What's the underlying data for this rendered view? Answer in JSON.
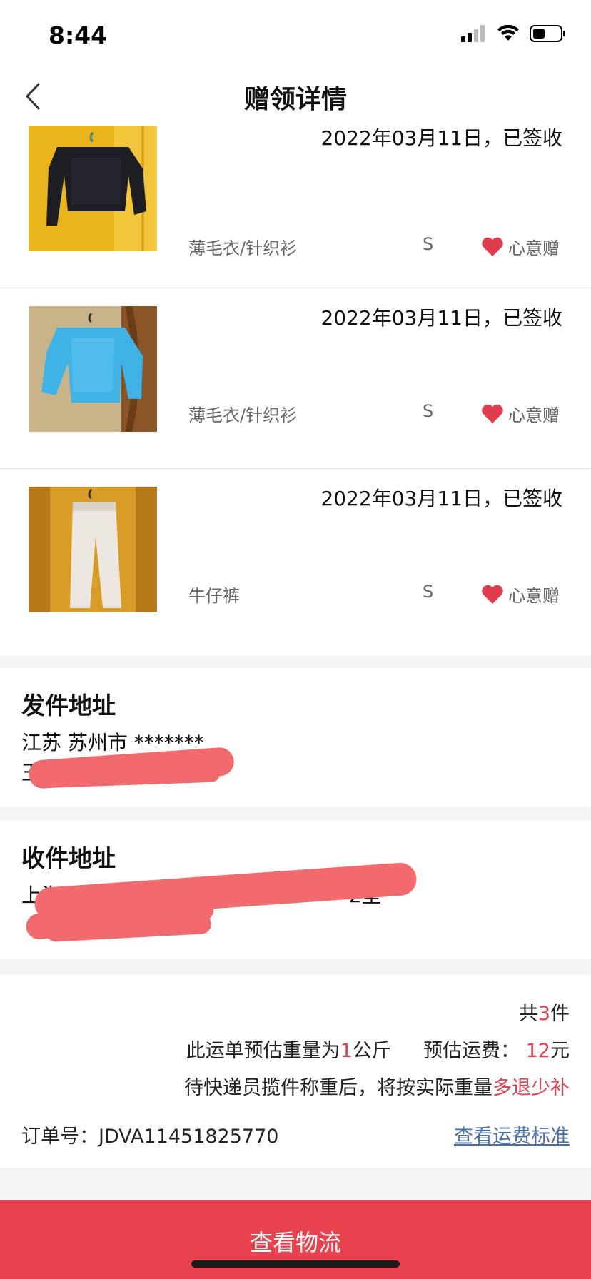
{
  "status_bar": {
    "time": "8:44"
  },
  "header": {
    "title": "赠领详情"
  },
  "items": [
    {
      "date": "2022年03月11日，已签收",
      "category": "薄毛衣/针织衫",
      "size": "S",
      "tag": "心意赠",
      "image": "black-sweater"
    },
    {
      "date": "2022年03月11日，已签收",
      "category": "薄毛衣/针织衫",
      "size": "S",
      "tag": "心意赠",
      "image": "blue-sweater"
    },
    {
      "date": "2022年03月11日，已签收",
      "category": "牛仔裤",
      "size": "S",
      "tag": "心意赠",
      "image": "white-jeans"
    }
  ],
  "sender": {
    "title": "发件地址",
    "line1": "江苏 苏州市 *******",
    "line2": "王"
  },
  "receiver": {
    "title": "收件地址",
    "line1_start": "上海 浦东新",
    "line1_end": "2室",
    "line2": ""
  },
  "summary": {
    "count_prefix": "共",
    "count": "3",
    "count_suffix": "件",
    "weight_prefix": "此运单预估重量为",
    "weight": "1",
    "weight_unit": "公斤",
    "fee_label": "预估运费：",
    "fee": "12",
    "fee_unit": "元",
    "note_prefix": "待快递员揽件称重后，将按实际重量",
    "note_highlight": "多退少补",
    "order_label": "订单号：",
    "order_no": "JDVA11451825770",
    "fee_link": "查看运费标准"
  },
  "bottom_button": {
    "label": "查看物流"
  },
  "colors": {
    "accent": "#e8424f",
    "link": "#4c6fa3",
    "heart": "#e23b4e"
  }
}
